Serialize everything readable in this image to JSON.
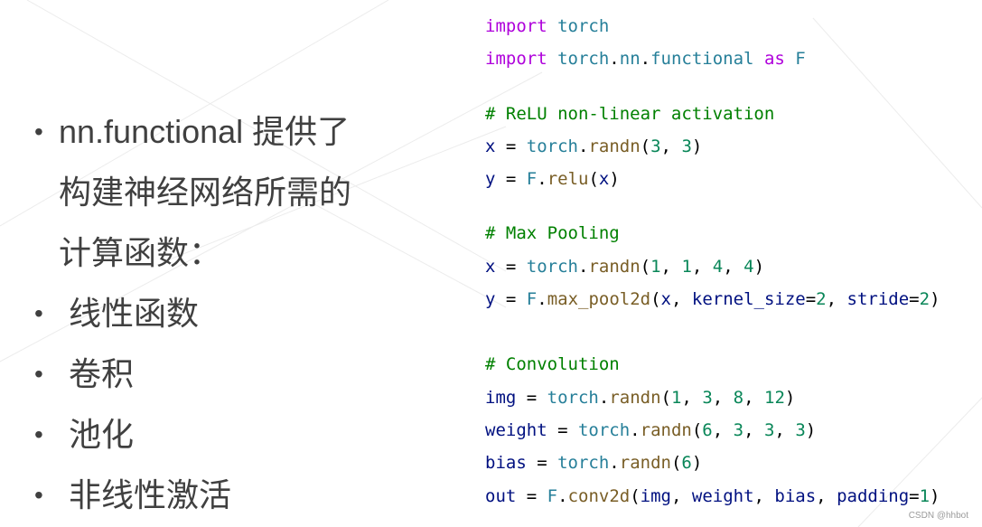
{
  "slide": {
    "bullets": [
      {
        "text_lines": [
          "nn.functional 提供了",
          "构建神经网络所需的",
          "计算函数："
        ]
      },
      {
        "text": "线性函数"
      },
      {
        "text": "卷积"
      },
      {
        "text": "池化"
      },
      {
        "text": "非线性激活"
      }
    ],
    "bullet_glyph": "•"
  },
  "code": {
    "lines": [
      {
        "tokens": [
          {
            "t": "import",
            "c": "kw"
          },
          {
            "t": " ",
            "c": "pn"
          },
          {
            "t": "torch",
            "c": "mod"
          }
        ]
      },
      {
        "tokens": [
          {
            "t": "import",
            "c": "kw"
          },
          {
            "t": " ",
            "c": "pn"
          },
          {
            "t": "torch",
            "c": "mod"
          },
          {
            "t": ".",
            "c": "pn"
          },
          {
            "t": "nn",
            "c": "mod"
          },
          {
            "t": ".",
            "c": "pn"
          },
          {
            "t": "functional",
            "c": "mod"
          },
          {
            "t": " ",
            "c": "pn"
          },
          {
            "t": "as",
            "c": "kw"
          },
          {
            "t": " ",
            "c": "pn"
          },
          {
            "t": "F",
            "c": "mod"
          }
        ]
      },
      {
        "gap": true
      },
      {
        "tokens": [
          {
            "t": "# ReLU non-linear activation",
            "c": "cm"
          }
        ]
      },
      {
        "tokens": [
          {
            "t": "x",
            "c": "var"
          },
          {
            "t": " = ",
            "c": "pn"
          },
          {
            "t": "torch",
            "c": "mod"
          },
          {
            "t": ".",
            "c": "pn"
          },
          {
            "t": "randn",
            "c": "fn"
          },
          {
            "t": "(",
            "c": "pn"
          },
          {
            "t": "3",
            "c": "num"
          },
          {
            "t": ", ",
            "c": "pn"
          },
          {
            "t": "3",
            "c": "num"
          },
          {
            "t": ")",
            "c": "pn"
          }
        ]
      },
      {
        "tokens": [
          {
            "t": "y",
            "c": "var"
          },
          {
            "t": " = ",
            "c": "pn"
          },
          {
            "t": "F",
            "c": "mod"
          },
          {
            "t": ".",
            "c": "pn"
          },
          {
            "t": "relu",
            "c": "fn"
          },
          {
            "t": "(",
            "c": "pn"
          },
          {
            "t": "x",
            "c": "var"
          },
          {
            "t": ")",
            "c": "pn"
          }
        ]
      },
      {
        "gap": true
      },
      {
        "tokens": [
          {
            "t": "# Max Pooling",
            "c": "cm"
          }
        ]
      },
      {
        "tokens": [
          {
            "t": "x",
            "c": "var"
          },
          {
            "t": " = ",
            "c": "pn"
          },
          {
            "t": "torch",
            "c": "mod"
          },
          {
            "t": ".",
            "c": "pn"
          },
          {
            "t": "randn",
            "c": "fn"
          },
          {
            "t": "(",
            "c": "pn"
          },
          {
            "t": "1",
            "c": "num"
          },
          {
            "t": ", ",
            "c": "pn"
          },
          {
            "t": "1",
            "c": "num"
          },
          {
            "t": ", ",
            "c": "pn"
          },
          {
            "t": "4",
            "c": "num"
          },
          {
            "t": ", ",
            "c": "pn"
          },
          {
            "t": "4",
            "c": "num"
          },
          {
            "t": ")",
            "c": "pn"
          }
        ]
      },
      {
        "tokens": [
          {
            "t": "y",
            "c": "var"
          },
          {
            "t": " = ",
            "c": "pn"
          },
          {
            "t": "F",
            "c": "mod"
          },
          {
            "t": ".",
            "c": "pn"
          },
          {
            "t": "max_pool2d",
            "c": "fn"
          },
          {
            "t": "(",
            "c": "pn"
          },
          {
            "t": "x",
            "c": "var"
          },
          {
            "t": ", ",
            "c": "pn"
          },
          {
            "t": "kernel_size",
            "c": "var"
          },
          {
            "t": "=",
            "c": "pn"
          },
          {
            "t": "2",
            "c": "num"
          },
          {
            "t": ", ",
            "c": "pn"
          },
          {
            "t": "stride",
            "c": "var"
          },
          {
            "t": "=",
            "c": "pn"
          },
          {
            "t": "2",
            "c": "num"
          },
          {
            "t": ")",
            "c": "pn"
          }
        ]
      },
      {
        "gap2": true
      },
      {
        "tokens": [
          {
            "t": "# Convolution",
            "c": "cm"
          }
        ]
      },
      {
        "tokens": [
          {
            "t": "img",
            "c": "var"
          },
          {
            "t": " = ",
            "c": "pn"
          },
          {
            "t": "torch",
            "c": "mod"
          },
          {
            "t": ".",
            "c": "pn"
          },
          {
            "t": "randn",
            "c": "fn"
          },
          {
            "t": "(",
            "c": "pn"
          },
          {
            "t": "1",
            "c": "num"
          },
          {
            "t": ", ",
            "c": "pn"
          },
          {
            "t": "3",
            "c": "num"
          },
          {
            "t": ", ",
            "c": "pn"
          },
          {
            "t": "8",
            "c": "num"
          },
          {
            "t": ", ",
            "c": "pn"
          },
          {
            "t": "12",
            "c": "num"
          },
          {
            "t": ")",
            "c": "pn"
          }
        ]
      },
      {
        "tokens": [
          {
            "t": "weight",
            "c": "var"
          },
          {
            "t": " = ",
            "c": "pn"
          },
          {
            "t": "torch",
            "c": "mod"
          },
          {
            "t": ".",
            "c": "pn"
          },
          {
            "t": "randn",
            "c": "fn"
          },
          {
            "t": "(",
            "c": "pn"
          },
          {
            "t": "6",
            "c": "num"
          },
          {
            "t": ", ",
            "c": "pn"
          },
          {
            "t": "3",
            "c": "num"
          },
          {
            "t": ", ",
            "c": "pn"
          },
          {
            "t": "3",
            "c": "num"
          },
          {
            "t": ", ",
            "c": "pn"
          },
          {
            "t": "3",
            "c": "num"
          },
          {
            "t": ")",
            "c": "pn"
          }
        ]
      },
      {
        "tokens": [
          {
            "t": "bias",
            "c": "var"
          },
          {
            "t": " = ",
            "c": "pn"
          },
          {
            "t": "torch",
            "c": "mod"
          },
          {
            "t": ".",
            "c": "pn"
          },
          {
            "t": "randn",
            "c": "fn"
          },
          {
            "t": "(",
            "c": "pn"
          },
          {
            "t": "6",
            "c": "num"
          },
          {
            "t": ")",
            "c": "pn"
          }
        ]
      },
      {
        "tokens": [
          {
            "t": "out",
            "c": "var"
          },
          {
            "t": " = ",
            "c": "pn"
          },
          {
            "t": "F",
            "c": "mod"
          },
          {
            "t": ".",
            "c": "pn"
          },
          {
            "t": "conv2d",
            "c": "fn"
          },
          {
            "t": "(",
            "c": "pn"
          },
          {
            "t": "img",
            "c": "var"
          },
          {
            "t": ", ",
            "c": "pn"
          },
          {
            "t": "weight",
            "c": "var"
          },
          {
            "t": ", ",
            "c": "pn"
          },
          {
            "t": "bias",
            "c": "var"
          },
          {
            "t": ", ",
            "c": "pn"
          },
          {
            "t": "padding",
            "c": "var"
          },
          {
            "t": "=",
            "c": "pn"
          },
          {
            "t": "1",
            "c": "num"
          },
          {
            "t": ")",
            "c": "pn"
          }
        ]
      }
    ]
  },
  "watermark": "CSDN @hhbot",
  "colors": {
    "text": "#404040",
    "keyword": "#af00db",
    "module": "#267f99",
    "function": "#795e26",
    "number": "#098658",
    "variable": "#001080",
    "comment": "#008000"
  }
}
